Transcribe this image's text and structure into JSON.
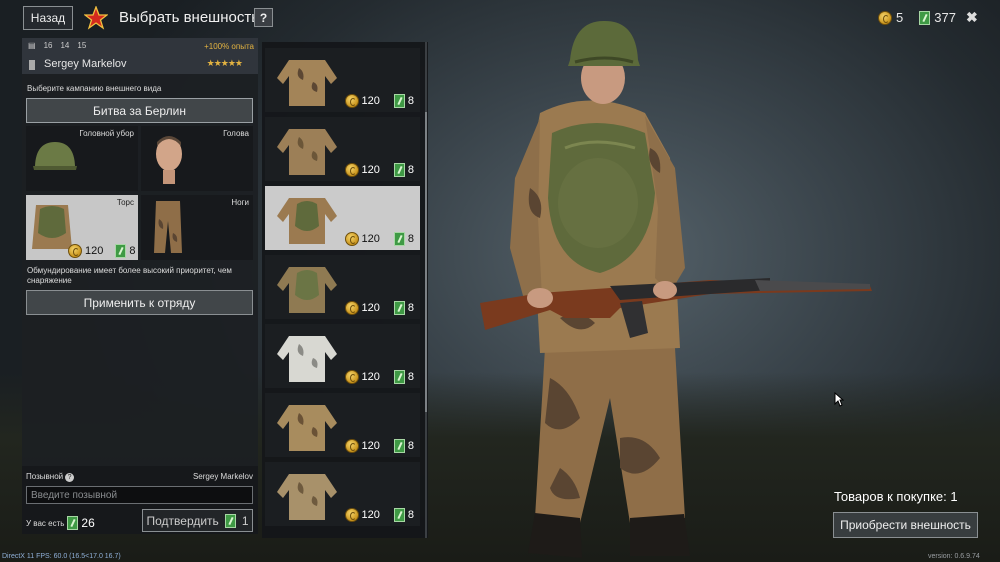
{
  "header": {
    "back_label": "Назад",
    "title": "Выбрать внешность",
    "help_label": "?"
  },
  "currency": {
    "gold": "5",
    "tickets": "377",
    "close": "✖"
  },
  "profile": {
    "stat1": "16",
    "stat2": "14",
    "stat3": "15",
    "bonus": "+100% опыта",
    "name": "Sergey Markelov",
    "stars": "★★★★★"
  },
  "campaign": {
    "label": "Выберите кампанию внешнего вида",
    "value": "Битва за Берлин"
  },
  "slots": {
    "helmet": "Головной убор",
    "head": "Голова",
    "torso": "Торс",
    "legs": "Ноги",
    "torso_price_gold": "120",
    "torso_price_tickets": "8"
  },
  "warning": "Обмундирование имеет более высокий приоритет, чем снаряжение",
  "apply_label": "Применить к отряду",
  "callsign": {
    "label": "Позывной",
    "name": "Sergey Markelov",
    "placeholder": "Введите позывной",
    "have_label": "У вас есть",
    "have_value": "26",
    "confirm_label": "Подтвердить",
    "confirm_cost": "1"
  },
  "items": [
    {
      "gold": "120",
      "tickets": "8",
      "selected": false
    },
    {
      "gold": "120",
      "tickets": "8",
      "selected": false
    },
    {
      "gold": "120",
      "tickets": "8",
      "selected": true
    },
    {
      "gold": "120",
      "tickets": "8",
      "selected": false
    },
    {
      "gold": "120",
      "tickets": "8",
      "selected": false
    },
    {
      "gold": "120",
      "tickets": "8",
      "selected": false
    },
    {
      "gold": "120",
      "tickets": "8",
      "selected": false
    }
  ],
  "purchase": {
    "count_label": "Товаров к покупке: 1",
    "buy_label": "Приобрести внешность"
  },
  "footer": {
    "fps": "DirectX 11 FPS: 60.0 (16.5<17.0 16.7)",
    "version": "version: 0.6.9.74"
  },
  "colors": {
    "gold": "#e3b341",
    "ticket_green": "#3f9a45",
    "selected_bg": "#c7c7c7"
  }
}
